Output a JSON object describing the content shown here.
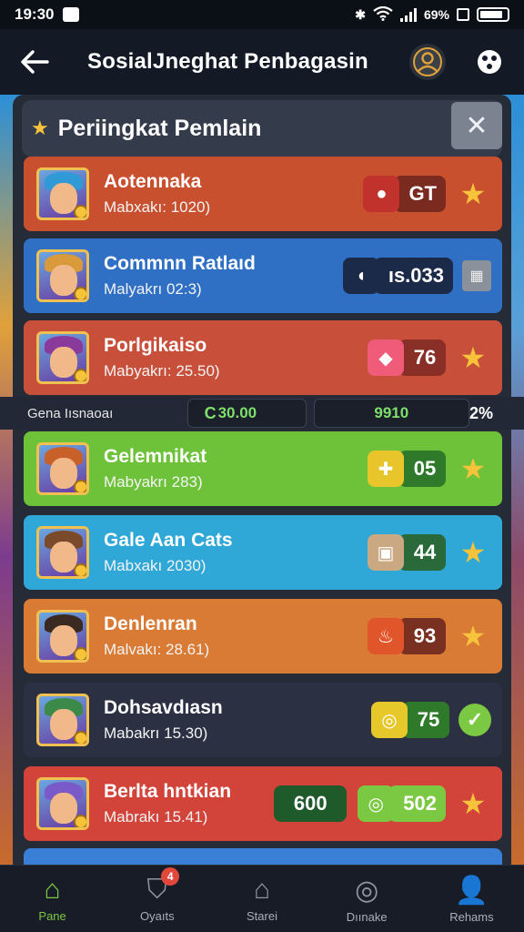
{
  "status_bar": {
    "time": "19:30",
    "battery_text": "69%"
  },
  "header": {
    "title": "SosialJneghat Penbagasin"
  },
  "panel": {
    "title": "Periingkat Pemlain"
  },
  "rows": [
    {
      "name": "Aotennaka",
      "sub": "Mabxakı: 1020)",
      "value": "GT",
      "color": "#c9502e",
      "icon_bg": "#c0322b",
      "value_bg": "#7a2a1f",
      "icon": "apple-icon",
      "end": "star"
    },
    {
      "name": "Commnn Ratlaıd",
      "sub": "Malyakrı 02:3)",
      "value": "ıs.033",
      "color": "#2f6fc4",
      "icon_bg": "#1c2a4a",
      "value_bg": "#1c2a4a",
      "icon": "coin-icon",
      "end": "grey"
    },
    {
      "name": "Porlgikaiso",
      "sub": "Mabyakrı: 25.50)",
      "value": "76",
      "color": "#c8503a",
      "icon_bg": "#f05b7a",
      "value_bg": "#8a2f27",
      "icon": "gem-icon",
      "end": "star"
    },
    {
      "name": "Gelemnikat",
      "sub": "Mabyakrı 283)",
      "value": "05",
      "color": "#6ec23a",
      "icon_bg": "#e8c52a",
      "value_bg": "#2e7a2a",
      "icon": "plus-icon",
      "end": "star"
    },
    {
      "name": "Gale Aan Cats",
      "sub": "Mabxakı 2030)",
      "value": "44",
      "color": "#2fa8d8",
      "icon_bg": "#c9a882",
      "value_bg": "#2a6a3a",
      "icon": "chest-icon",
      "end": "star"
    },
    {
      "name": "Denlenran",
      "sub": "Malvakı: 28.61)",
      "value": "93",
      "color": "#d97a35",
      "icon_bg": "#e0562a",
      "value_bg": "#7a3020",
      "icon": "fire-icon",
      "end": "star"
    },
    {
      "name": "Dohsavdıasn",
      "sub": "Mabakrı 15.30)",
      "value": "75",
      "color": "#2b3142",
      "icon_bg": "#e7c82a",
      "value_bg": "#2e7a2a",
      "icon": "ring-icon",
      "end": "check"
    },
    {
      "name": "Berlta hntkian",
      "sub": "Mabrakı 15.41)",
      "value": "502",
      "prefix_value": "600",
      "color": "#d2443a",
      "icon_bg": "#7bc843",
      "value_bg": "#7bc843",
      "icon": "ring-icon",
      "end": "star"
    }
  ],
  "summary": {
    "label": "Gena Iısnaoaı",
    "box_a": "30.00",
    "box_b": "9910",
    "percent": "2%"
  },
  "nav": [
    {
      "label": "Pane",
      "icon": "home-icon",
      "active": true
    },
    {
      "label": "Oyaıts",
      "icon": "shield-icon",
      "badge": "4"
    },
    {
      "label": "Starei",
      "icon": "store-icon"
    },
    {
      "label": "Dıınake",
      "icon": "search-icon"
    },
    {
      "label": "Rehams",
      "icon": "people-icon"
    }
  ]
}
